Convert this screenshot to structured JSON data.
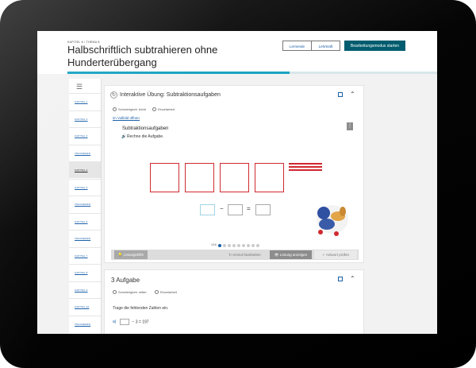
{
  "header": {
    "breadcrumb": "KAPITEL 6 / THEMA 6",
    "title": "Halbschriftlich subtrahieren ohne Hunderterübergang",
    "btn_lernende": "Lernende",
    "btn_lehrkraft": "Lehrkraft",
    "btn_start": "Bearbeitungsmodus starten"
  },
  "progress": {
    "fraction": 0.6
  },
  "sidebar": {
    "items": [
      {
        "label": "KAPITEL 1"
      },
      {
        "label": "KAPITEL 2"
      },
      {
        "label": "KAPITEL 3"
      },
      {
        "label": "TRAINIEREN"
      },
      {
        "label": "KAPITEL 4"
      },
      {
        "label": "KAPITEL 5"
      },
      {
        "label": "TRAINIEREN"
      },
      {
        "label": "KAPITEL 6"
      },
      {
        "label": "TRAINIEREN"
      },
      {
        "label": "KAPITEL 7"
      },
      {
        "label": "KAPITEL 8"
      },
      {
        "label": "KAPITEL 9"
      },
      {
        "label": "KAPITEL 10"
      },
      {
        "label": "TRAINIEREN"
      }
    ]
  },
  "exercise": {
    "title": "Interaktive Übung: Subtraktionsaufgaben",
    "difficulty": "Schwierigkeit: leicht",
    "mode": "Einzelarbeit",
    "fullscreen": "im Vollbild öffnen",
    "subtitle": "Subtraktionsaufgaben",
    "instruction": "Rechne die Aufgabe.",
    "minus": "−",
    "equals": "=",
    "pager": "1/16",
    "btn_hint": "Lösungshilfe",
    "btn_retry": "erneut bearbeiten",
    "btn_show": "Lösung anzeigen",
    "btn_check": "Antwort prüfen"
  },
  "task3": {
    "title": "3 Aufgabe",
    "difficulty": "Schwierigkeit: mittel",
    "mode": "Einzelarbeit",
    "instruction": "Trage die fehlenden Zahlen ein.",
    "item_label": "a)",
    "item_expr": "− 3 = 197"
  }
}
